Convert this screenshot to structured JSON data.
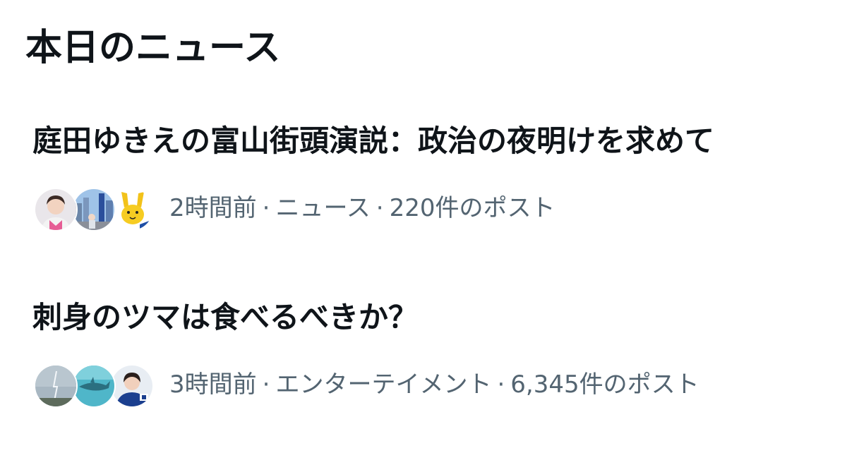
{
  "section": {
    "title": "本日のニュース"
  },
  "items": [
    {
      "headline": "庭田ゆきえの富山街頭演説：政治の夜明けを求めて",
      "time": "2時間前",
      "category": "ニュース",
      "posts": "220件のポスト",
      "separator": "·",
      "avatars": [
        "woman-portrait-avatar",
        "city-street-avatar",
        "yellow-rabbit-mascot-avatar"
      ]
    },
    {
      "headline": "刺身のツマは食べるべきか？",
      "time": "3時間前",
      "category": "エンターテイメント",
      "posts": "6,345件のポスト",
      "separator": "·",
      "avatars": [
        "lightning-sky-avatar",
        "aquarium-shark-avatar",
        "woman-headset-avatar"
      ]
    }
  ],
  "colors": {
    "text_primary": "#0f1419",
    "text_secondary": "#536471",
    "background": "#ffffff"
  }
}
